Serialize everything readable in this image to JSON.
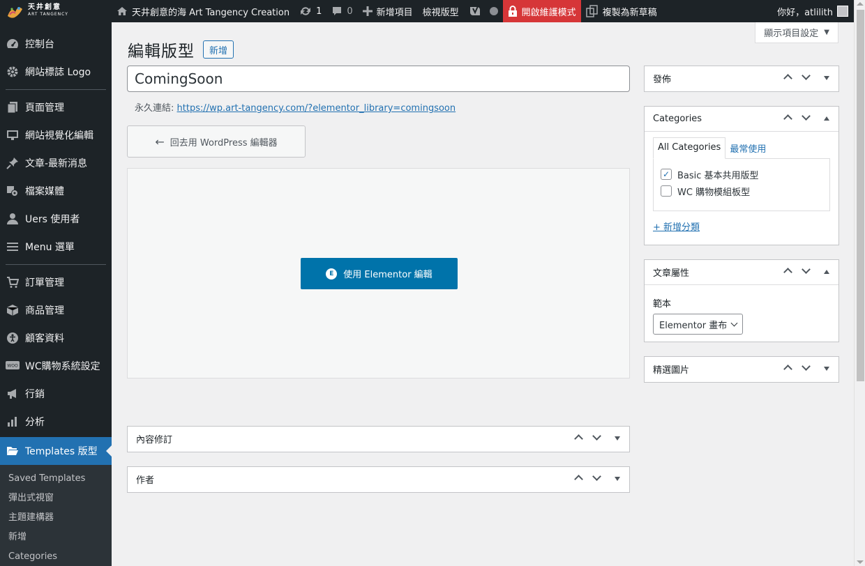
{
  "adminbar": {
    "logo_line1": "天井創意",
    "logo_line2": "ART TANGENCY",
    "site_name": "天井創意的海 Art Tangency Creation",
    "updates_count": "1",
    "comments_count": "0",
    "new_item": "新增項目",
    "view_template": "檢視版型",
    "maintenance": "開啟維護模式",
    "copy_draft": "複製為新草稿",
    "greeting": "你好，atlilith"
  },
  "sidebar": {
    "items": [
      {
        "label": "控制台",
        "icon": "dashboard-icon"
      },
      {
        "label": "網站標誌 Logo",
        "icon": "gear-icon"
      },
      {
        "label": "頁面管理",
        "icon": "pages-icon"
      },
      {
        "label": "網站視覺化編輯",
        "icon": "appearance-icon"
      },
      {
        "label": "文章-最新消息",
        "icon": "pin-icon"
      },
      {
        "label": "檔案媒體",
        "icon": "media-icon"
      },
      {
        "label": "Uers 使用者",
        "icon": "user-icon"
      },
      {
        "label": "Menu 選單",
        "icon": "menu-icon"
      },
      {
        "label": "訂單管理",
        "icon": "cart-icon"
      },
      {
        "label": "商品管理",
        "icon": "box-icon"
      },
      {
        "label": "顧客資料",
        "icon": "accessibility-icon"
      },
      {
        "label": "WC購物系統設定",
        "icon": "woo-icon"
      },
      {
        "label": "行銷",
        "icon": "megaphone-icon"
      },
      {
        "label": "分析",
        "icon": "chart-bar-icon"
      },
      {
        "label": "Templates 版型",
        "icon": "folder-open-icon"
      }
    ],
    "submenu": [
      "Saved Templates",
      "彈出式視窗",
      "主題建構器",
      "新增",
      "Categories"
    ]
  },
  "screen_options": "顯示項目設定",
  "page": {
    "title": "編輯版型",
    "add_new": "新增",
    "post_title": "ComingSoon",
    "permalink_label": "永久連結:",
    "permalink_url": "https://wp.art-tangency.com/?elementor_library=comingsoon",
    "back_button": "回去用 WordPress 編輯器",
    "elementor_button": "使用 Elementor 編輯",
    "elementor_icon_glyph": "E"
  },
  "metaboxes": {
    "revisions": "內容修訂",
    "author": "作者",
    "publish": "發佈",
    "categories": {
      "title": "Categories",
      "tab_all": "All Categories",
      "tab_popular": "最常使用",
      "items": [
        {
          "label": "Basic 基本共用版型",
          "checked": true
        },
        {
          "label": "WC 購物模組板型",
          "checked": false
        }
      ],
      "add_new": "+ 新增分類"
    },
    "attributes": {
      "title": "文章屬性",
      "template_label": "範本",
      "template_value": "Elementor 畫布"
    },
    "featured_image": "精選圖片"
  },
  "colors": {
    "admin_dark": "#1d2327",
    "accent": "#2271b1",
    "elementor_blue": "#0073aa",
    "maintenance_red": "#d63638"
  }
}
